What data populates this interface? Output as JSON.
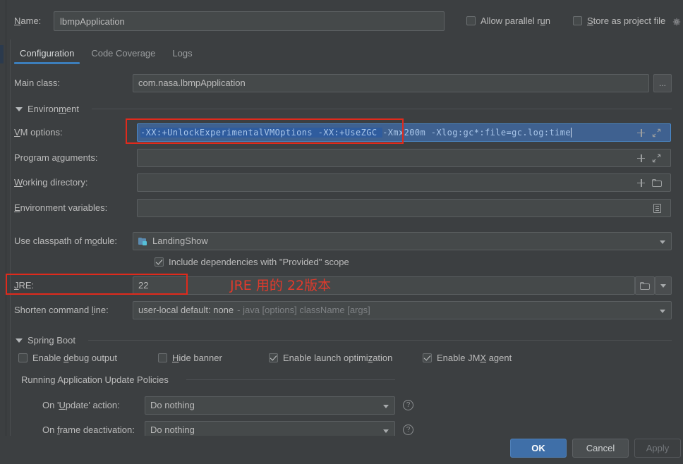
{
  "window": {
    "name_label": "Name:",
    "name_label_mn": "N",
    "name_value": "lbmpApplication",
    "allow_parallel_run": {
      "label_pre": "Allow parallel r",
      "label_mn": "u",
      "label_post": "n",
      "checked": false
    },
    "store_as_project_file": {
      "label_pre": "",
      "label_mn": "S",
      "label_post": "tore as project file",
      "checked": false
    },
    "gear_icon": "gear-icon"
  },
  "tabs": [
    {
      "label": "Configuration",
      "active": true
    },
    {
      "label": "Code Coverage",
      "active": false
    },
    {
      "label": "Logs",
      "active": false
    }
  ],
  "form": {
    "main_class": {
      "label": "Main class:",
      "value": "com.nasa.lbmpApplication",
      "browse_button": "..."
    },
    "environment_section": {
      "label_pre": "Environ",
      "label_mn": "m",
      "label_post": "ent",
      "expanded": true
    },
    "vm_options": {
      "label_pre": "",
      "label_mn": "V",
      "label_post": "M options:",
      "selected_text": "-XX:+UnlockExperimentalVMOptions -XX:+UseZGC ",
      "rest_text": "-Xmx200m  -Xlog:gc*:file=gc.log:time",
      "full_value": "-XX:+UnlockExperimentalVMOptions -XX:+UseZGC -Xmx200m  -Xlog:gc*:file=gc.log:time",
      "icons": [
        "plus-icon",
        "expand-icon"
      ]
    },
    "program_arguments": {
      "label_pre": "Program a",
      "label_mn": "r",
      "label_post": "guments:",
      "value": "",
      "icons": [
        "plus-icon",
        "expand-icon"
      ]
    },
    "working_directory": {
      "label_pre": "",
      "label_mn": "W",
      "label_post": "orking directory:",
      "value": "",
      "icons": [
        "plus-icon",
        "folder-icon"
      ]
    },
    "environment_variables": {
      "label_pre": "",
      "label_mn": "E",
      "label_post": "nvironment variables:",
      "value": "",
      "icons": [
        "list-icon"
      ]
    },
    "use_classpath_of_module": {
      "label_pre": "Use classpath of m",
      "label_mn": "o",
      "label_post": "dule:",
      "value": "LandingShow",
      "icon": "module-icon"
    },
    "include_dependencies": {
      "label": "Include dependencies with \"Provided\" scope",
      "checked": true
    },
    "jre": {
      "label_pre": "",
      "label_mn": "J",
      "label_post": "RE:",
      "value": "22",
      "icons": [
        "folder-icon",
        "dropdown-icon"
      ]
    },
    "shorten_command_line": {
      "label_pre": "Shorten command ",
      "label_mn": "l",
      "label_post": "ine:",
      "value": "user-local default: none",
      "hint": "- java [options] className [args]"
    }
  },
  "spring_boot": {
    "section_label_pre": "Sprin",
    "section_label_mn": "g",
    "section_label_post": " Boot",
    "checkboxes": [
      {
        "pre": "Enable ",
        "mn": "d",
        "post": "ebug output",
        "checked": false
      },
      {
        "pre": "",
        "mn": "H",
        "post": "ide banner",
        "checked": false
      },
      {
        "pre": "Enable launch optimi",
        "mn": "z",
        "post": "ation",
        "checked": true
      },
      {
        "pre": "Enable JM",
        "mn": "X",
        "post": " agent",
        "checked": true
      }
    ],
    "update_policies": {
      "title": "Running Application Update Policies",
      "rows": [
        {
          "label_pre": "On '",
          "label_mn": "U",
          "label_post": "pdate' action:",
          "value": "Do nothing",
          "help": "?"
        },
        {
          "label_pre": "On ",
          "label_mn": "f",
          "label_post": "rame deactivation:",
          "value": "Do nothing",
          "help": "?"
        }
      ]
    }
  },
  "buttons": {
    "ok": "OK",
    "cancel": "Cancel",
    "apply": "Apply"
  },
  "annotations": {
    "jre_note": "JRE 用的 22版本",
    "color": "#e03a2c"
  },
  "colors": {
    "background": "#3c3f41",
    "field_bg": "#45494a",
    "accent_blue": "#3c7ebb",
    "selection_blue": "#2f5c9e",
    "annotation_red": "#e03a2c",
    "text": "#bbbbbb"
  }
}
